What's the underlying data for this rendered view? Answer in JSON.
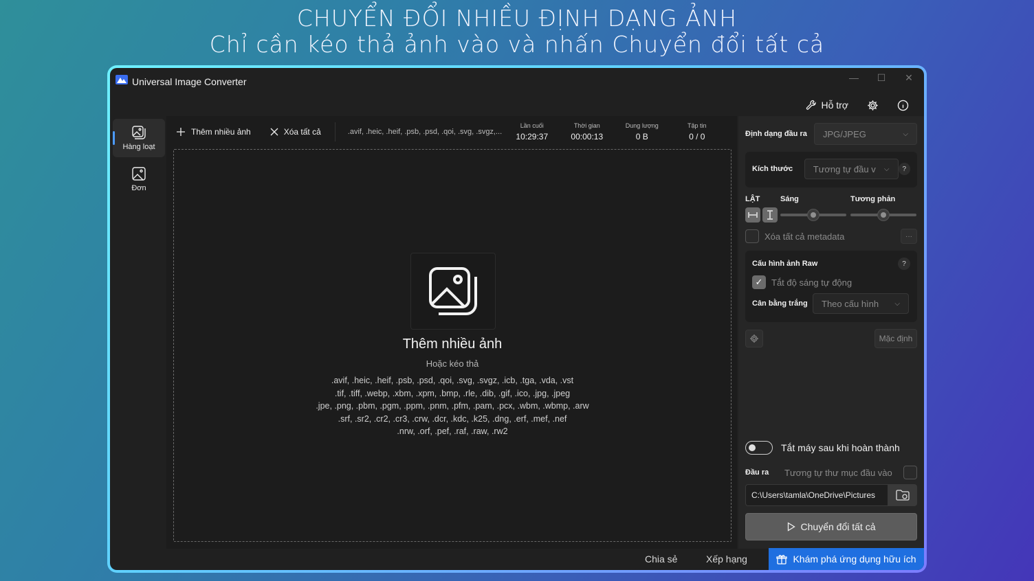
{
  "headline": {
    "line1": "CHUYỂN ĐỔI NHIỀU ĐỊNH DẠNG ẢNH",
    "line2": "Chỉ cần kéo thả ảnh vào và nhấn Chuyển đổi tất cả"
  },
  "window": {
    "title": "Universal Image Converter",
    "controls": {
      "minimize": "—",
      "maximize": "☐",
      "close": "✕"
    }
  },
  "topbar": {
    "help_label": "Hỗ trợ",
    "icons": [
      "wrench-icon",
      "gear-icon",
      "info-icon"
    ]
  },
  "sidebar": {
    "items": [
      {
        "label": "Hàng loạt",
        "icon": "images-icon",
        "active": true
      },
      {
        "label": "Đơn",
        "icon": "image-icon",
        "active": false
      }
    ]
  },
  "toolbar": {
    "add_label": "Thêm nhiều ảnh",
    "clear_label": "Xóa tất cả",
    "extensions": ".avif, .heic, .heif, .psb, .psd, .qoi, .svg, .svgz,...",
    "stats": [
      {
        "label": "Lần cuối",
        "value": "10:29:37"
      },
      {
        "label": "Thời gian",
        "value": "00:00:13"
      },
      {
        "label": "Dung lượng",
        "value": "0 B"
      },
      {
        "label": "Tập tin",
        "value": "0 / 0"
      }
    ]
  },
  "dropzone": {
    "title": "Thêm nhiều ảnh",
    "subtitle": "Hoặc kéo thả",
    "formats": [
      ".avif, .heic, .heif, .psb, .psd, .qoi, .svg, .svgz, .icb, .tga, .vda, .vst",
      ".tif, .tiff, .webp, .xbm, .xpm, .bmp, .rle, .dib, .gif, .ico, .jpg, .jpeg",
      ".jpe, .png, .pbm, .pgm, .ppm, .pnm, .pfm, .pam, .pcx, .wbm, .wbmp, .arw",
      ".srf, .sr2, .cr2, .cr3, .crw, .dcr, .kdc, .k25, .dng, .erf, .mef, .nef",
      ".nrw, .orf, .pef, .raf, .raw, .rw2"
    ]
  },
  "settings": {
    "output_format_label": "Định dạng đầu ra",
    "output_format_value": "JPG/JPEG",
    "size_label": "Kích thước",
    "size_value": "Tương tự đầu v",
    "flip_label": "LẬT",
    "brightness_label": "Sáng",
    "contrast_label": "Tương phản",
    "brightness_level": 0.5,
    "contrast_level": 0.5,
    "metadata_label": "Xóa tất cả metadata",
    "metadata_more": "···",
    "raw_title": "Cấu hình ảnh Raw",
    "auto_bright_label": "Tắt độ sáng tự động",
    "white_balance_label": "Cân bằng trắng",
    "white_balance_value": "Theo cấu hình",
    "default_label": "Mặc định",
    "shutdown_label": "Tắt máy sau khi hoàn thành",
    "output_label": "Đầu ra",
    "same_folder_label": "Tương tự thư mục đầu vào",
    "output_path": "C:\\Users\\tamla\\OneDrive\\Pictures",
    "convert_label": "Chuyển đổi tất cả"
  },
  "footer": {
    "share_label": "Chia sẻ",
    "rate_label": "Xếp hạng",
    "explore_label": "Khám phá ứng dụng hữu ích"
  }
}
